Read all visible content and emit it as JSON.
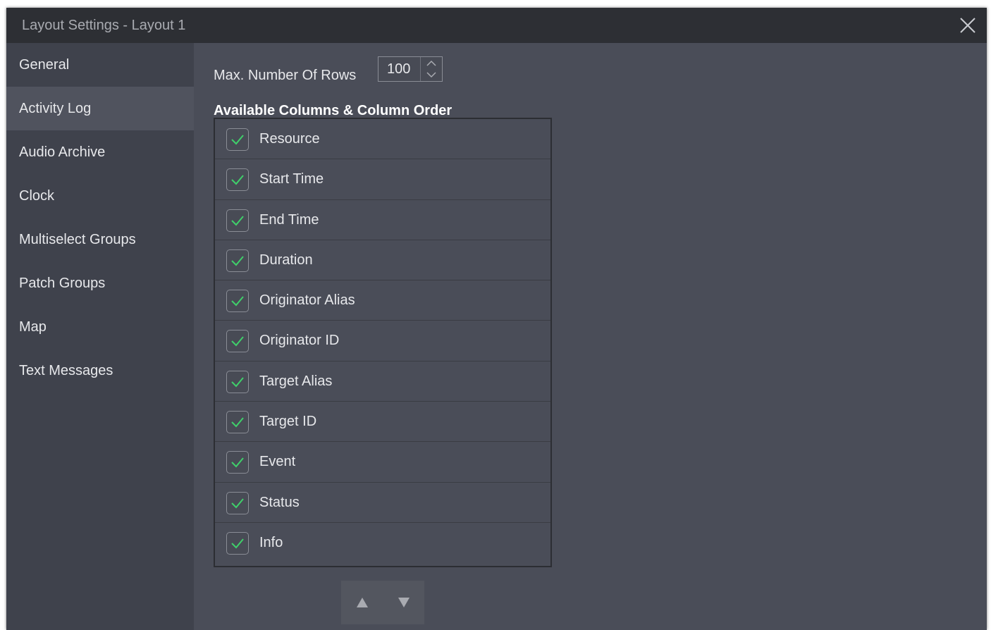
{
  "window": {
    "title": "Layout Settings - Layout 1"
  },
  "sidebar": {
    "items": [
      {
        "label": "General"
      },
      {
        "label": "Activity Log"
      },
      {
        "label": "Audio Archive"
      },
      {
        "label": "Clock"
      },
      {
        "label": "Multiselect Groups"
      },
      {
        "label": "Patch Groups"
      },
      {
        "label": "Map"
      },
      {
        "label": "Text Messages"
      }
    ],
    "active_item": "Activity Log"
  },
  "settings": {
    "max_rows_label": "Max. Number Of Rows",
    "max_rows_value": "100",
    "columns_heading": "Available Columns & Column Order",
    "columns": [
      {
        "label": "Resource",
        "checked": true
      },
      {
        "label": "Start Time",
        "checked": true
      },
      {
        "label": "End Time",
        "checked": true
      },
      {
        "label": "Duration",
        "checked": true
      },
      {
        "label": "Originator Alias",
        "checked": true
      },
      {
        "label": "Originator ID",
        "checked": true
      },
      {
        "label": "Target Alias",
        "checked": true
      },
      {
        "label": "Target ID",
        "checked": true
      },
      {
        "label": "Event",
        "checked": true
      },
      {
        "label": "Status",
        "checked": true
      },
      {
        "label": "Info",
        "checked": true
      }
    ]
  },
  "icons": {
    "close": "close-icon",
    "spinner_up": "chevron-up-icon",
    "spinner_down": "chevron-down-icon",
    "checkbox": "check-icon",
    "move_up": "triangle-up-icon",
    "move_down": "triangle-down-icon"
  },
  "colors": {
    "titlebar": "#2d2f34",
    "sidebar": "#3f424c",
    "sidebar_active": "#50535e",
    "panel": "#4a4d58",
    "check_green": "#3fd06a",
    "text": "#e7e8eb"
  }
}
